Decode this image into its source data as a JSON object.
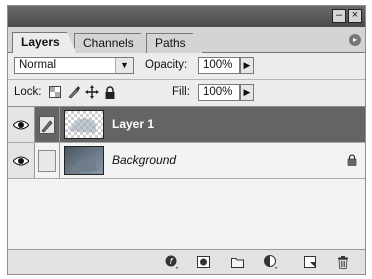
{
  "window": {
    "minimize_glyph": "–",
    "close_glyph": "×"
  },
  "tabs": [
    {
      "label": "Layers",
      "active": true
    },
    {
      "label": "Channels",
      "active": false
    },
    {
      "label": "Paths",
      "active": false
    }
  ],
  "menu_glyph": "▸",
  "blend_mode": {
    "value": "Normal",
    "arrow": "▼"
  },
  "opacity": {
    "label": "Opacity:",
    "value": "100%",
    "step": "▶"
  },
  "lock": {
    "label": "Lock:"
  },
  "fill": {
    "label": "Fill:",
    "value": "100%",
    "step": "▶"
  },
  "layers": [
    {
      "name": "Layer 1",
      "selected": true,
      "italic": false,
      "locked": false
    },
    {
      "name": "Background",
      "selected": false,
      "italic": true,
      "locked": true
    }
  ],
  "footer_icons": [
    "link-layers-icon",
    "layer-style-icon",
    "layer-mask-icon",
    "new-group-icon",
    "adjustment-layer-icon",
    "new-layer-icon",
    "trash-icon"
  ],
  "colors": {
    "selected_row": "#646464",
    "panel_bg": "#ececec",
    "title_bar": "#5a5a5a"
  }
}
